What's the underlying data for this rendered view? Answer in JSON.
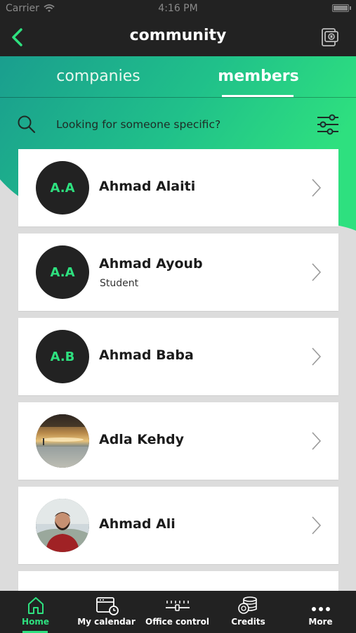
{
  "status_bar": {
    "carrier": "Carrier",
    "time": "4:16 PM"
  },
  "nav": {
    "title": "community"
  },
  "tabs": [
    {
      "label": "companies",
      "active": false
    },
    {
      "label": "members",
      "active": true
    }
  ],
  "search": {
    "placeholder": "Looking for someone specific?"
  },
  "members": [
    {
      "initials": "A.A",
      "name": "Ahmad Alaiti",
      "subtitle": ""
    },
    {
      "initials": "A.A",
      "name": "Ahmad Ayoub",
      "subtitle": "Student"
    },
    {
      "initials": "A.B",
      "name": "Ahmad Baba",
      "subtitle": ""
    },
    {
      "initials": "",
      "name": "Adla Kehdy",
      "subtitle": "",
      "photo": "sunset-photo"
    },
    {
      "initials": "",
      "name": "Ahmad Ali",
      "subtitle": "",
      "photo": "person-photo"
    }
  ],
  "tab_bar": [
    {
      "label": "Home",
      "icon": "home-icon",
      "active": true
    },
    {
      "label": "My calendar",
      "icon": "calendar-icon",
      "active": false
    },
    {
      "label": "Office control",
      "icon": "sliders-icon",
      "active": false
    },
    {
      "label": "Credits",
      "icon": "coins-icon",
      "active": false
    },
    {
      "label": "More",
      "icon": "more-icon",
      "active": false
    }
  ],
  "colors": {
    "accent": "#2ee07f",
    "dark": "#222222",
    "teal": "#1fa08a",
    "background": "#dcdcdc"
  }
}
